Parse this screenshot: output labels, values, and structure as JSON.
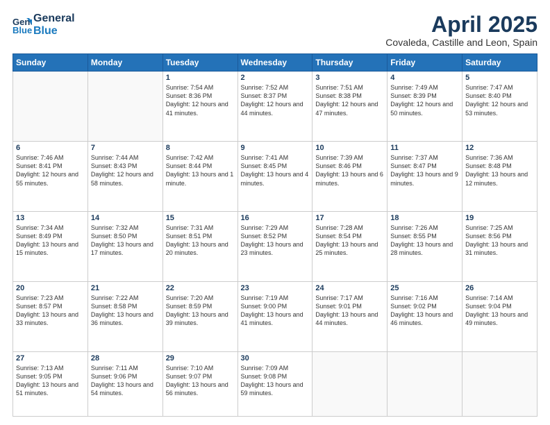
{
  "header": {
    "logo_line1": "General",
    "logo_line2": "Blue",
    "title": "April 2025",
    "subtitle": "Covaleda, Castille and Leon, Spain"
  },
  "weekdays": [
    "Sunday",
    "Monday",
    "Tuesday",
    "Wednesday",
    "Thursday",
    "Friday",
    "Saturday"
  ],
  "weeks": [
    [
      {
        "day": "",
        "text": ""
      },
      {
        "day": "",
        "text": ""
      },
      {
        "day": "1",
        "text": "Sunrise: 7:54 AM\nSunset: 8:36 PM\nDaylight: 12 hours and 41 minutes."
      },
      {
        "day": "2",
        "text": "Sunrise: 7:52 AM\nSunset: 8:37 PM\nDaylight: 12 hours and 44 minutes."
      },
      {
        "day": "3",
        "text": "Sunrise: 7:51 AM\nSunset: 8:38 PM\nDaylight: 12 hours and 47 minutes."
      },
      {
        "day": "4",
        "text": "Sunrise: 7:49 AM\nSunset: 8:39 PM\nDaylight: 12 hours and 50 minutes."
      },
      {
        "day": "5",
        "text": "Sunrise: 7:47 AM\nSunset: 8:40 PM\nDaylight: 12 hours and 53 minutes."
      }
    ],
    [
      {
        "day": "6",
        "text": "Sunrise: 7:46 AM\nSunset: 8:41 PM\nDaylight: 12 hours and 55 minutes."
      },
      {
        "day": "7",
        "text": "Sunrise: 7:44 AM\nSunset: 8:43 PM\nDaylight: 12 hours and 58 minutes."
      },
      {
        "day": "8",
        "text": "Sunrise: 7:42 AM\nSunset: 8:44 PM\nDaylight: 13 hours and 1 minute."
      },
      {
        "day": "9",
        "text": "Sunrise: 7:41 AM\nSunset: 8:45 PM\nDaylight: 13 hours and 4 minutes."
      },
      {
        "day": "10",
        "text": "Sunrise: 7:39 AM\nSunset: 8:46 PM\nDaylight: 13 hours and 6 minutes."
      },
      {
        "day": "11",
        "text": "Sunrise: 7:37 AM\nSunset: 8:47 PM\nDaylight: 13 hours and 9 minutes."
      },
      {
        "day": "12",
        "text": "Sunrise: 7:36 AM\nSunset: 8:48 PM\nDaylight: 13 hours and 12 minutes."
      }
    ],
    [
      {
        "day": "13",
        "text": "Sunrise: 7:34 AM\nSunset: 8:49 PM\nDaylight: 13 hours and 15 minutes."
      },
      {
        "day": "14",
        "text": "Sunrise: 7:32 AM\nSunset: 8:50 PM\nDaylight: 13 hours and 17 minutes."
      },
      {
        "day": "15",
        "text": "Sunrise: 7:31 AM\nSunset: 8:51 PM\nDaylight: 13 hours and 20 minutes."
      },
      {
        "day": "16",
        "text": "Sunrise: 7:29 AM\nSunset: 8:52 PM\nDaylight: 13 hours and 23 minutes."
      },
      {
        "day": "17",
        "text": "Sunrise: 7:28 AM\nSunset: 8:54 PM\nDaylight: 13 hours and 25 minutes."
      },
      {
        "day": "18",
        "text": "Sunrise: 7:26 AM\nSunset: 8:55 PM\nDaylight: 13 hours and 28 minutes."
      },
      {
        "day": "19",
        "text": "Sunrise: 7:25 AM\nSunset: 8:56 PM\nDaylight: 13 hours and 31 minutes."
      }
    ],
    [
      {
        "day": "20",
        "text": "Sunrise: 7:23 AM\nSunset: 8:57 PM\nDaylight: 13 hours and 33 minutes."
      },
      {
        "day": "21",
        "text": "Sunrise: 7:22 AM\nSunset: 8:58 PM\nDaylight: 13 hours and 36 minutes."
      },
      {
        "day": "22",
        "text": "Sunrise: 7:20 AM\nSunset: 8:59 PM\nDaylight: 13 hours and 39 minutes."
      },
      {
        "day": "23",
        "text": "Sunrise: 7:19 AM\nSunset: 9:00 PM\nDaylight: 13 hours and 41 minutes."
      },
      {
        "day": "24",
        "text": "Sunrise: 7:17 AM\nSunset: 9:01 PM\nDaylight: 13 hours and 44 minutes."
      },
      {
        "day": "25",
        "text": "Sunrise: 7:16 AM\nSunset: 9:02 PM\nDaylight: 13 hours and 46 minutes."
      },
      {
        "day": "26",
        "text": "Sunrise: 7:14 AM\nSunset: 9:04 PM\nDaylight: 13 hours and 49 minutes."
      }
    ],
    [
      {
        "day": "27",
        "text": "Sunrise: 7:13 AM\nSunset: 9:05 PM\nDaylight: 13 hours and 51 minutes."
      },
      {
        "day": "28",
        "text": "Sunrise: 7:11 AM\nSunset: 9:06 PM\nDaylight: 13 hours and 54 minutes."
      },
      {
        "day": "29",
        "text": "Sunrise: 7:10 AM\nSunset: 9:07 PM\nDaylight: 13 hours and 56 minutes."
      },
      {
        "day": "30",
        "text": "Sunrise: 7:09 AM\nSunset: 9:08 PM\nDaylight: 13 hours and 59 minutes."
      },
      {
        "day": "",
        "text": ""
      },
      {
        "day": "",
        "text": ""
      },
      {
        "day": "",
        "text": ""
      }
    ]
  ]
}
